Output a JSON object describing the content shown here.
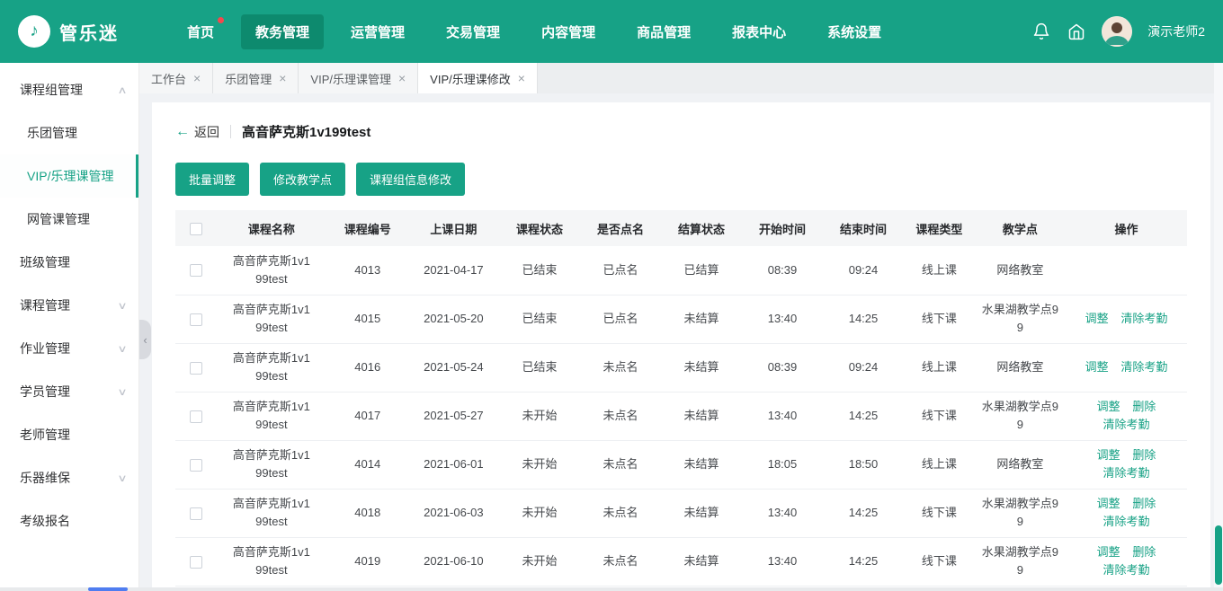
{
  "colors": {
    "accent": "#17A286",
    "accent_dark": "#0D8A6E",
    "badge_red": "#F5484D",
    "link": "#18A286",
    "content_bg": "#f0f2f5"
  },
  "icons": {
    "logo_note": "♪",
    "close": "×",
    "back_arrow": "←",
    "chevron_up": "∧",
    "chevron_down": "∨",
    "collapse_left": "‹"
  },
  "header": {
    "brand": "管乐迷",
    "nav": [
      {
        "label": "首页"
      },
      {
        "label": "教务管理"
      },
      {
        "label": "运营管理"
      },
      {
        "label": "交易管理"
      },
      {
        "label": "内容管理"
      },
      {
        "label": "商品管理"
      },
      {
        "label": "报表中心"
      },
      {
        "label": "系统设置"
      }
    ],
    "user_name": "演示老师2"
  },
  "sidebar": {
    "items": [
      {
        "label": "课程组管理"
      },
      {
        "label": "乐团管理"
      },
      {
        "label": "VIP/乐理课管理"
      },
      {
        "label": "网管课管理"
      },
      {
        "label": "班级管理"
      },
      {
        "label": "课程管理"
      },
      {
        "label": "作业管理"
      },
      {
        "label": "学员管理"
      },
      {
        "label": "老师管理"
      },
      {
        "label": "乐器维保"
      },
      {
        "label": "考级报名"
      }
    ]
  },
  "tabs": [
    {
      "label": "工作台"
    },
    {
      "label": "乐团管理"
    },
    {
      "label": "VIP/乐理课管理"
    },
    {
      "label": "VIP/乐理课修改"
    }
  ],
  "page": {
    "back": "返回",
    "title": "高音萨克斯1v199test",
    "buttons": {
      "batch_adjust": "批量调整",
      "modify_venue": "修改教学点",
      "modify_group": "课程组信息修改"
    }
  },
  "table": {
    "columns": [
      "课程名称",
      "课程编号",
      "上课日期",
      "课程状态",
      "是否点名",
      "结算状态",
      "开始时间",
      "结束时间",
      "课程类型",
      "教学点",
      "操作"
    ],
    "rows": [
      {
        "name": "高音萨克斯1v199test",
        "code": "4013",
        "date": "2021-04-17",
        "status": "已结束",
        "rollcall": "已点名",
        "settlement": "已结算",
        "start": "08:39",
        "end": "09:24",
        "type": "线上课",
        "venue": "网络教室",
        "actions": []
      },
      {
        "name": "高音萨克斯1v199test",
        "code": "4015",
        "date": "2021-05-20",
        "status": "已结束",
        "rollcall": "已点名",
        "settlement": "未结算",
        "start": "13:40",
        "end": "14:25",
        "type": "线下课",
        "venue": "水果湖教学点99",
        "actions": [
          "调整",
          "清除考勤"
        ]
      },
      {
        "name": "高音萨克斯1v199test",
        "code": "4016",
        "date": "2021-05-24",
        "status": "已结束",
        "rollcall": "未点名",
        "settlement": "未结算",
        "start": "08:39",
        "end": "09:24",
        "type": "线上课",
        "venue": "网络教室",
        "actions": [
          "调整",
          "清除考勤"
        ]
      },
      {
        "name": "高音萨克斯1v199test",
        "code": "4017",
        "date": "2021-05-27",
        "status": "未开始",
        "rollcall": "未点名",
        "settlement": "未结算",
        "start": "13:40",
        "end": "14:25",
        "type": "线下课",
        "venue": "水果湖教学点99",
        "actions": [
          "调整",
          "删除",
          "清除考勤"
        ]
      },
      {
        "name": "高音萨克斯1v199test",
        "code": "4014",
        "date": "2021-06-01",
        "status": "未开始",
        "rollcall": "未点名",
        "settlement": "未结算",
        "start": "18:05",
        "end": "18:50",
        "type": "线上课",
        "venue": "网络教室",
        "actions": [
          "调整",
          "删除",
          "清除考勤"
        ]
      },
      {
        "name": "高音萨克斯1v199test",
        "code": "4018",
        "date": "2021-06-03",
        "status": "未开始",
        "rollcall": "未点名",
        "settlement": "未结算",
        "start": "13:40",
        "end": "14:25",
        "type": "线下课",
        "venue": "水果湖教学点99",
        "actions": [
          "调整",
          "删除",
          "清除考勤"
        ]
      },
      {
        "name": "高音萨克斯1v199test",
        "code": "4019",
        "date": "2021-06-10",
        "status": "未开始",
        "rollcall": "未点名",
        "settlement": "未结算",
        "start": "13:40",
        "end": "14:25",
        "type": "线下课",
        "venue": "水果湖教学点99",
        "actions": [
          "调整",
          "删除",
          "清除考勤"
        ]
      }
    ]
  }
}
